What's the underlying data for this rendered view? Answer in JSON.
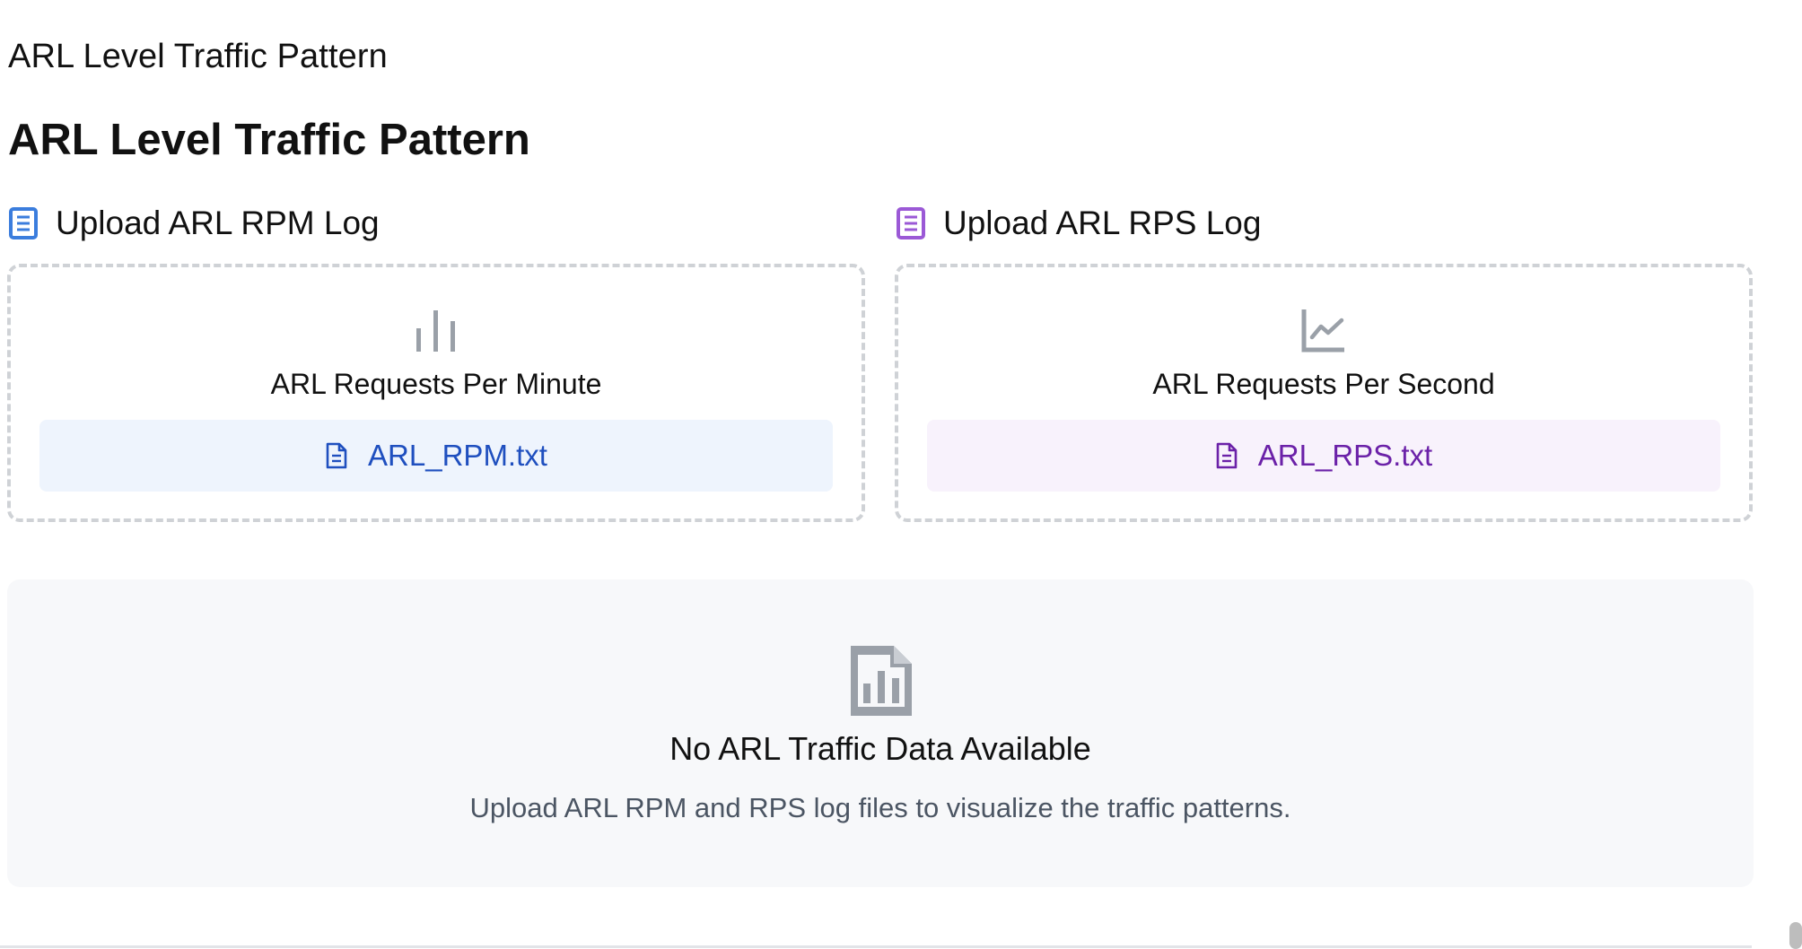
{
  "header": {
    "title_small": "ARL Level Traffic Pattern",
    "title_large": "ARL Level Traffic Pattern"
  },
  "uploads": [
    {
      "label": "Upload ARL RPM Log",
      "caption": "ARL Requests Per Minute",
      "file_name": "ARL_RPM.txt",
      "accent_color": "#3b7ddd",
      "icon": "bar-chart-icon"
    },
    {
      "label": "Upload ARL RPS Log",
      "caption": "ARL Requests Per Second",
      "file_name": "ARL_RPS.txt",
      "accent_color": "#9b59d6",
      "icon": "line-chart-icon"
    }
  ],
  "empty_state": {
    "title": "No ARL Traffic Data Available",
    "description": "Upload ARL RPM and RPS log files to visualize the traffic patterns.",
    "icon": "file-chart-icon"
  }
}
